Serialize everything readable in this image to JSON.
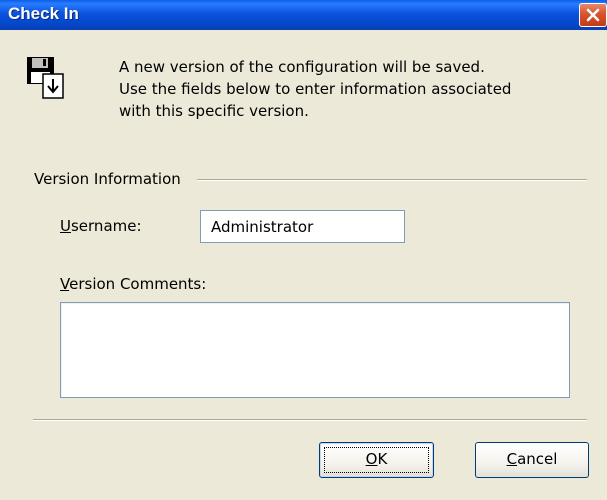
{
  "window": {
    "title": "Check In",
    "close_icon": "close-icon"
  },
  "intro": {
    "icon": "floppy-disk-save-icon",
    "lines": [
      "A new version of the configuration will be saved.",
      "Use the fields below to enter information associated",
      "with this specific version."
    ]
  },
  "group": {
    "label": "Version Information"
  },
  "username": {
    "label_mnemonic": "U",
    "label_rest": "sername:",
    "value": "Administrator"
  },
  "comments": {
    "label_mnemonic": "V",
    "label_rest": "ersion Comments:",
    "value": ""
  },
  "buttons": {
    "ok_mnemonic": "O",
    "ok_rest": "K",
    "cancel_mnemonic": "C",
    "cancel_rest": "ancel"
  }
}
